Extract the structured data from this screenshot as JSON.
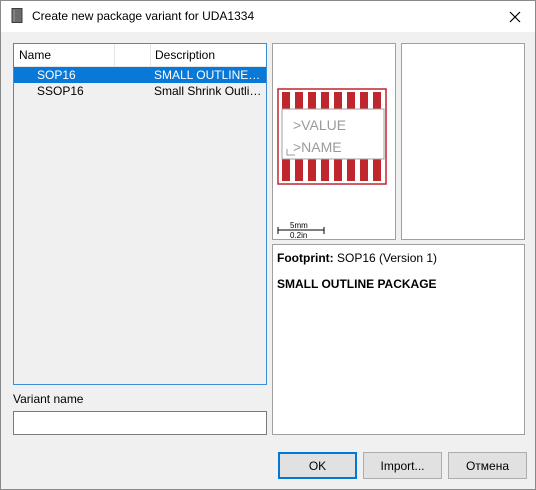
{
  "window": {
    "title": "Create new package variant for UDA1334"
  },
  "icons": {
    "app": "book-icon",
    "close": "close-icon"
  },
  "list": {
    "columns": [
      "Name",
      "",
      "Description"
    ],
    "rows": [
      {
        "name": "SOP16",
        "description": "SMALL OUTLINE PACKAGE",
        "selected": true
      },
      {
        "name": "SSOP16",
        "description": "Small Shrink Outline Package",
        "selected": false
      }
    ]
  },
  "variant": {
    "label": "Variant name",
    "value": ""
  },
  "preview": {
    "value_text": ">VALUE",
    "name_text": ">NAME",
    "scale_mm": "5mm",
    "scale_in": "0.2in"
  },
  "info": {
    "footprint_label": "Footprint:",
    "footprint_value": "SOP16 (Version 1)",
    "description": "SMALL OUTLINE PACKAGE"
  },
  "buttons": {
    "ok": "OK",
    "import": "Import...",
    "cancel": "Отмена"
  },
  "colors": {
    "selection": "#0a78d7",
    "focus_border": "#3c8dd6",
    "pad_red": "#c0262d",
    "default_button_border": "#0078d7"
  }
}
